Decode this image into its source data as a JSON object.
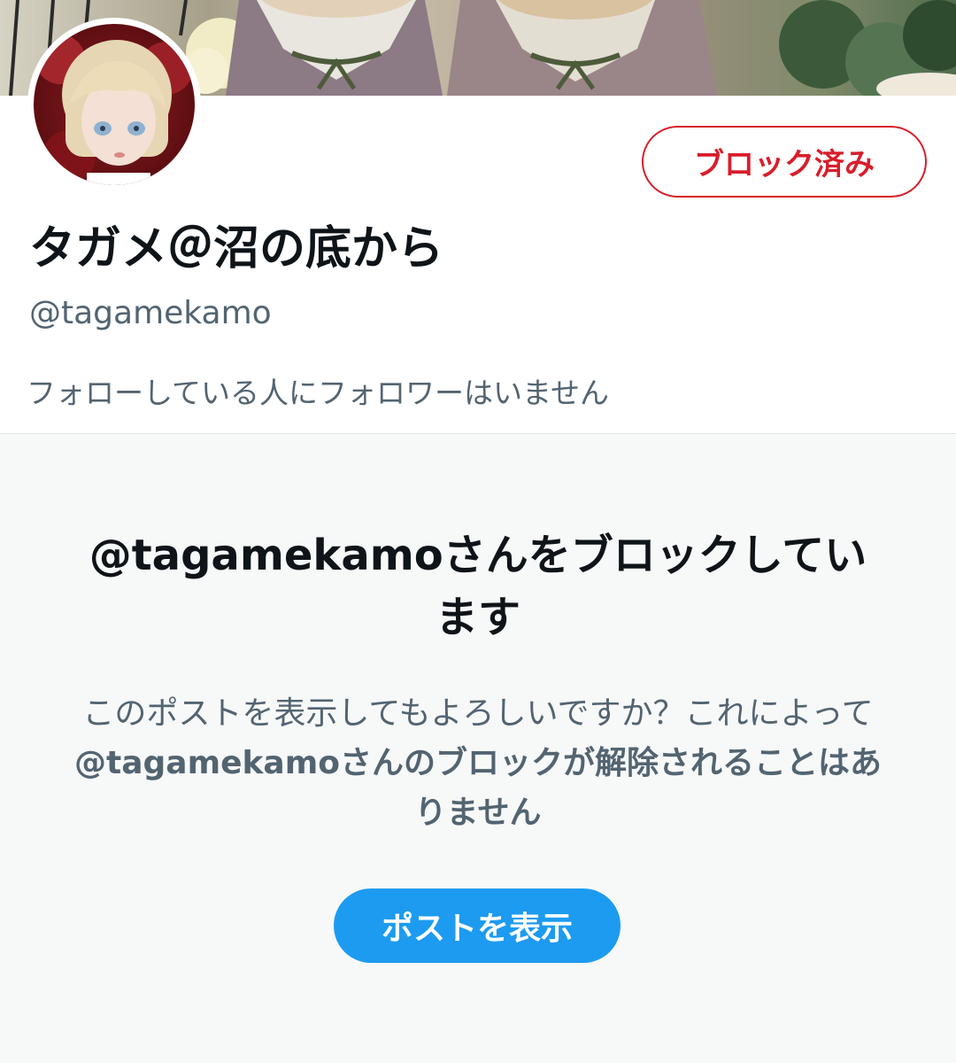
{
  "profile": {
    "display_name": "タガメ＠沼の底から",
    "handle": "@tagamekamo",
    "followers_note": "フォローしている人にフォロワーはいません",
    "blocked_button_label": "ブロック済み"
  },
  "blocked_notice": {
    "title": "@tagamekamoさんをブロックしています",
    "description_prefix": "このポストを表示してもよろしいですか？これによって",
    "description_bold": "@tagamekamoさんのブロックが解除されることはありません",
    "view_post_button": "ポストを表示"
  },
  "colors": {
    "block_red": "#d81e2b",
    "accent_blue": "#1d9bf0",
    "secondary_text": "#536471"
  }
}
